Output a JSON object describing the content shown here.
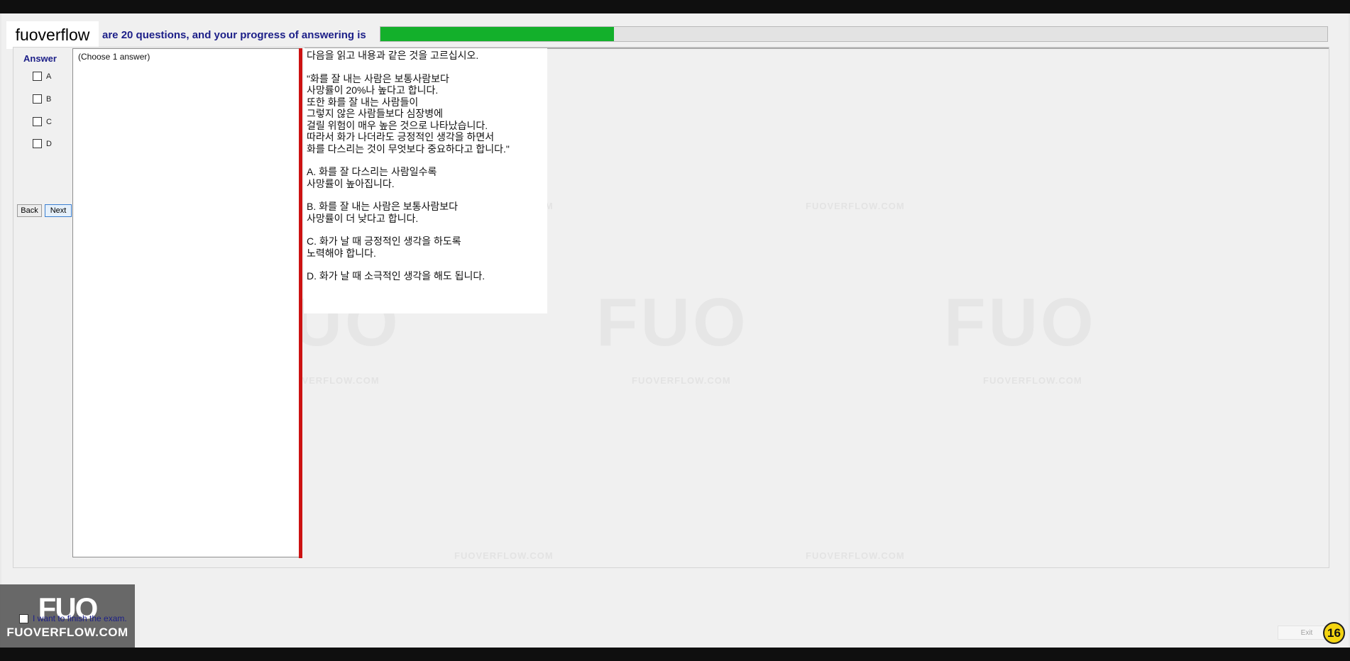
{
  "brand": {
    "label": "fuoverflow"
  },
  "progress": {
    "text": "are 20 questions, and your progress of answering is",
    "fraction": 0.247,
    "fill_color": "#13b02b"
  },
  "answer": {
    "title": "Answer",
    "options": [
      "A",
      "B",
      "C",
      "D"
    ]
  },
  "nav": {
    "back_label": "Back",
    "next_label": "Next"
  },
  "question": {
    "choose_label": "(Choose 1 answer)",
    "lines": [
      "다음을 읽고 내용과 같은 것을 고르십시오.",
      "",
      "\"화를 잘 내는 사람은 보통사람보다",
      "사망률이 20%나 높다고 합니다.",
      "또한 화를 잘 내는 사람들이",
      "그렇지 않은 사람들보다 심장병에",
      "걸릴 위험이 매우 높은 것으로 나타났습니다.",
      "따라서 화가 나더라도 긍정적인 생각을 하면서",
      "화를 다스리는 것이 무엇보다 중요하다고 합니다.\"",
      "",
      "A.  화를 잘 다스리는 사람일수록",
      "사망률이 높아집니다.",
      "",
      "B.  화를 잘 내는 사람은 보통사람보다",
      "사망률이 더 낮다고 합니다.",
      "",
      "C.  화가 날 때 긍정적인 생각을 하도록",
      "노력해야 합니다.",
      "",
      "D.  화가 날 때 소극적인 생각을 해도 됩니다."
    ]
  },
  "watermark": {
    "text": "FUOVERFLOW.COM"
  },
  "logo": {
    "mark": "FUO",
    "text": "FUOVERFLOW.COM"
  },
  "finish": {
    "label": "I want to finish the exam."
  },
  "exit": {
    "label": "Exit"
  },
  "page_badge": {
    "number": "16"
  }
}
